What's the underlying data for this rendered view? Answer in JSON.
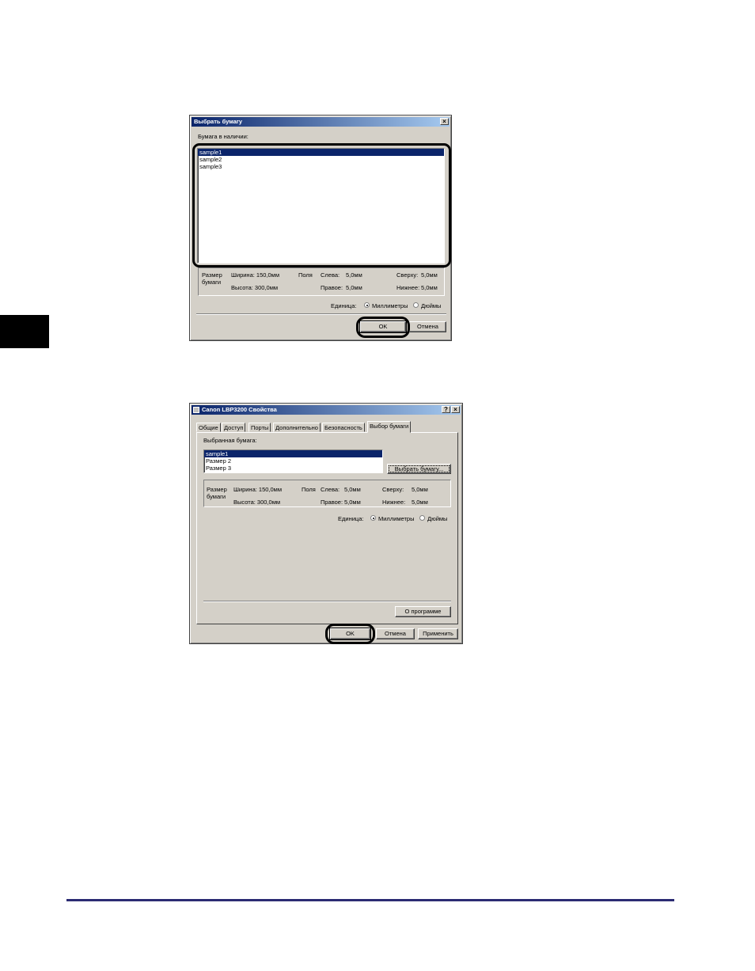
{
  "dialog1": {
    "title": "Выбрать бумагу",
    "close": "×",
    "list_label": "Бумага в наличии:",
    "items": [
      "sample1",
      "sample2",
      "sample3"
    ],
    "size_label": "Размер бумаги",
    "width": "Ширина: 150,0мм",
    "height": "Высота: 300,0мм",
    "margins_label": "Поля",
    "left": "Слева:",
    "left_val": "5,0мм",
    "right": "Правое:",
    "right_val": "5,0мм",
    "top": "Сверху:",
    "top_val": "5,0мм",
    "bottom": "Нижнее:",
    "bottom_val": "5,0мм",
    "unit_label": "Единица:",
    "unit_mm": "Миллиметры",
    "unit_in": "Дюймы",
    "ok": "OK",
    "cancel": "Отмена"
  },
  "dialog2": {
    "title": "Canon LBP3200 Свойства",
    "help": "?",
    "close": "×",
    "tabs": [
      "Общие",
      "Доступ",
      "Порты",
      "Дополнительно",
      "Безопасность",
      "Выбор бумаги"
    ],
    "selected_label": "Выбранная бумага:",
    "items": [
      "sample1",
      "Размер 2",
      "Размер 3"
    ],
    "choose_button": "Выбрать бумагу...",
    "size_label": "Размер бумаги",
    "width": "Ширина: 150,0мм",
    "height": "Высота: 300,0мм",
    "margins_label": "Поля",
    "left": "Слева:",
    "left_val": "5,0мм",
    "right": "Правое:",
    "right_val": "5,0мм",
    "top": "Сверху:",
    "top_val": "5,0мм",
    "bottom": "Нижнее:",
    "bottom_val": "5,0мм",
    "unit_label": "Единица:",
    "unit_mm": "Миллиметры",
    "unit_in": "Дюймы",
    "about": "О программе",
    "ok": "OK",
    "cancel": "Отмена",
    "apply": "Применить"
  },
  "colors": {
    "accent": "#0a246a",
    "footer_rule": "#2b2b73",
    "window_face": "#d4d0c8"
  }
}
